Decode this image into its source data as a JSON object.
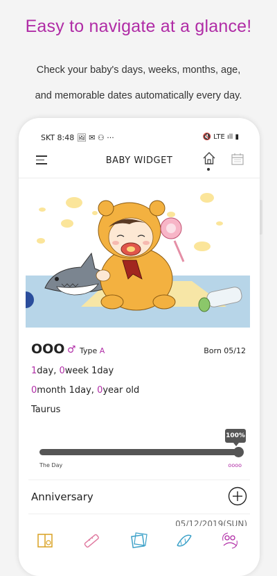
{
  "promo": {
    "title": "Easy to navigate at a glance!",
    "subtitle_line1": "Check your baby's days, weeks, months, age,",
    "subtitle_line2": "and memorable dates automatically every day."
  },
  "status_bar": {
    "left": "SKT 8:48 🖼 ✉ ⚇  ···",
    "right": "🔇 LTE ıll ▮"
  },
  "app_bar": {
    "title": "BABY WIDGET",
    "icons": [
      "menu-icon",
      "home-icon",
      "calendar-icon"
    ]
  },
  "profile": {
    "name": "OOO",
    "gender_symbol": "♂",
    "type_label": "Type",
    "type_value": "A",
    "born": "Born 05/12",
    "line1": {
      "n1": "1",
      "t1": "day, ",
      "n2": "0",
      "t2": "week 1day"
    },
    "line2": {
      "n1": "0",
      "t1": "month 1day, ",
      "n2": "0",
      "t2": "year old"
    },
    "zodiac": "Taurus"
  },
  "progress": {
    "badge": "100%",
    "value": 1.0,
    "start_label": "The Day",
    "end_label": "oooo"
  },
  "anniversary": {
    "title": "Anniversary",
    "add_icon": "plus-circle-icon",
    "date": "05/12/2019(SUN)"
  },
  "bottom_nav": [
    "diary-icon",
    "growth-ruler-icon",
    "vaccination-icon",
    "dna-icon",
    "family-icon"
  ],
  "colors": {
    "accent": "#b02ca6",
    "dark": "#555555"
  }
}
